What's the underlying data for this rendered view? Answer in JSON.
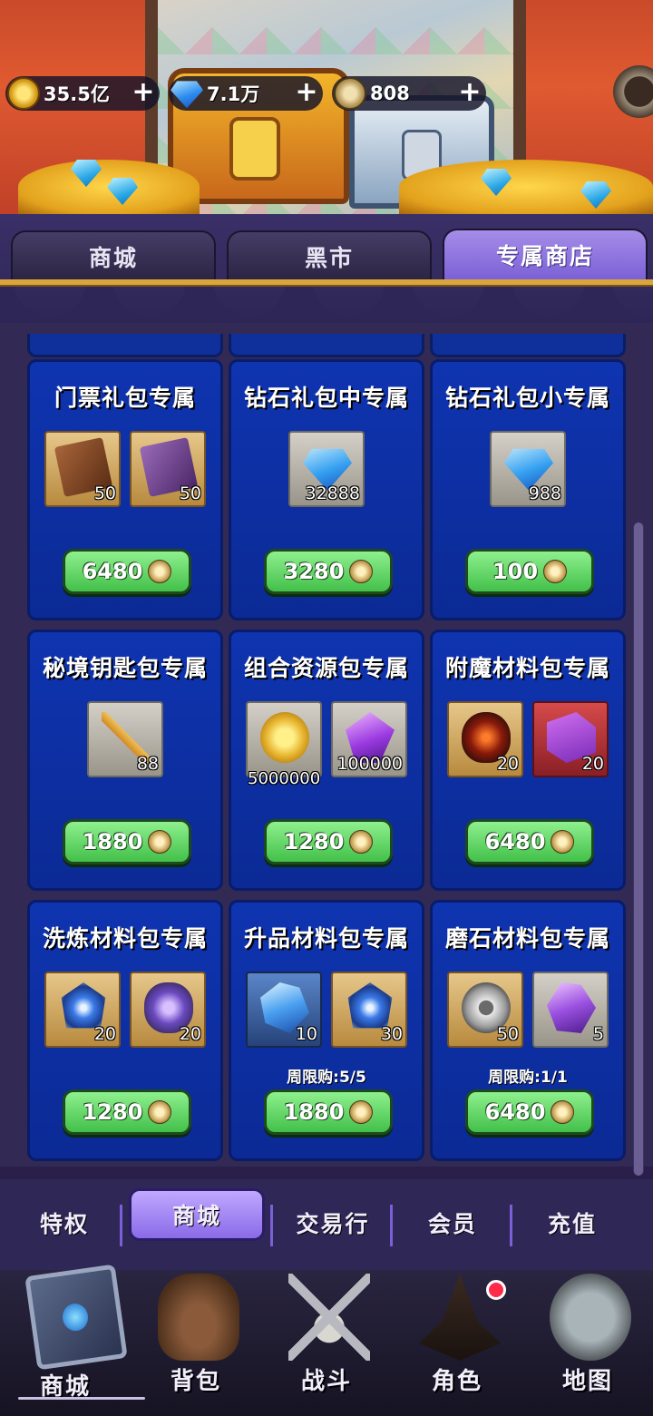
{
  "currencies": [
    {
      "name": "gold-coin",
      "value": "35.5亿",
      "icon": "gold-coin-icon"
    },
    {
      "name": "diamond",
      "value": "7.1万",
      "icon": "diamond-icon"
    },
    {
      "name": "medal-coin",
      "value": "808",
      "icon": "medal-coin-icon"
    }
  ],
  "tabs": [
    {
      "label": "商城",
      "active": false
    },
    {
      "label": "黑市",
      "active": false
    },
    {
      "label": "专属商店",
      "active": true
    }
  ],
  "cards": [
    {
      "title": "门票礼包专属",
      "items": [
        {
          "icon": "ticket-icon",
          "qty": "50"
        },
        {
          "icon": "ticket-icon",
          "qty": "50"
        }
      ],
      "price": "6480",
      "limit": ""
    },
    {
      "title": "钻石礼包中专属",
      "items": [
        {
          "icon": "diamond-icon",
          "qty": "32888"
        }
      ],
      "price": "3280",
      "limit": ""
    },
    {
      "title": "钻石礼包小专属",
      "items": [
        {
          "icon": "diamond-icon",
          "qty": "988"
        }
      ],
      "price": "100",
      "limit": ""
    },
    {
      "title": "秘境钥匙包专属",
      "items": [
        {
          "icon": "key-icon",
          "qty": "88"
        }
      ],
      "price": "1880",
      "limit": ""
    },
    {
      "title": "组合资源包专属",
      "items": [
        {
          "icon": "gold-coin-icon",
          "qty": "5000000"
        },
        {
          "icon": "crystal-icon",
          "qty": "100000"
        }
      ],
      "price": "1280",
      "limit": ""
    },
    {
      "title": "附魔材料包专属",
      "items": [
        {
          "icon": "lava-stone-icon",
          "qty": "20"
        },
        {
          "icon": "purple-slab-icon",
          "qty": "20"
        }
      ],
      "price": "6480",
      "limit": ""
    },
    {
      "title": "洗炼材料包专属",
      "items": [
        {
          "icon": "blue-gem-icon",
          "qty": "20"
        },
        {
          "icon": "purple-stone-icon",
          "qty": "20"
        }
      ],
      "price": "1280",
      "limit": ""
    },
    {
      "title": "升品材料包专属",
      "items": [
        {
          "icon": "ice-crystal-icon",
          "qty": "10"
        },
        {
          "icon": "blue-gem-icon",
          "qty": "30"
        }
      ],
      "price": "1880",
      "limit": "周限购:5/5"
    },
    {
      "title": "磨石材料包专属",
      "items": [
        {
          "icon": "whetstone-icon",
          "qty": "50"
        },
        {
          "icon": "amethyst-icon",
          "qty": "5"
        }
      ],
      "price": "6480",
      "limit": "周限购:1/1"
    }
  ],
  "subnav": [
    {
      "label": "特权",
      "active": false
    },
    {
      "label": "商城",
      "active": true
    },
    {
      "label": "交易行",
      "active": false
    },
    {
      "label": "会员",
      "active": false
    },
    {
      "label": "充值",
      "active": false
    }
  ],
  "bottomnav": [
    {
      "label": "商城",
      "icon": "spellbook-icon",
      "active": true
    },
    {
      "label": "背包",
      "icon": "backpack-icon",
      "active": false
    },
    {
      "label": "战斗",
      "icon": "crossed-swords-skull-icon",
      "active": false
    },
    {
      "label": "角色",
      "icon": "wizard-hat-icon",
      "active": false
    },
    {
      "label": "地图",
      "icon": "map-icon",
      "active": false
    }
  ],
  "colors": {
    "accent": "#8a6ae8",
    "card_bg": "#0f34b0",
    "price_button": "#5ad05a",
    "notification": "#ff2a4a"
  }
}
